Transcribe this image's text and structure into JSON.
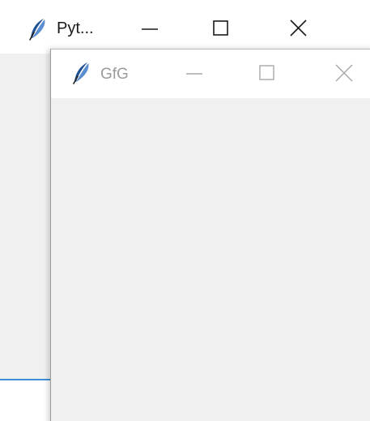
{
  "back_window": {
    "title": "Pyt...",
    "icon": "feather-icon",
    "controls": {
      "minimize_icon": "minimize-icon",
      "maximize_icon": "maximize-icon",
      "close_icon": "close-icon"
    },
    "colors": {
      "titlebar": "#ffffff",
      "title_text": "#1a1a1a",
      "client": "#f0f0f0",
      "accent": "#3c8fd6"
    }
  },
  "front_window": {
    "title": "GfG",
    "icon": "feather-icon",
    "controls": {
      "minimize_icon": "minimize-icon",
      "maximize_icon": "maximize-icon",
      "close_icon": "close-icon"
    },
    "colors": {
      "titlebar": "#ffffff",
      "title_text": "#9b9b9b",
      "client": "#f0f0f0"
    }
  }
}
